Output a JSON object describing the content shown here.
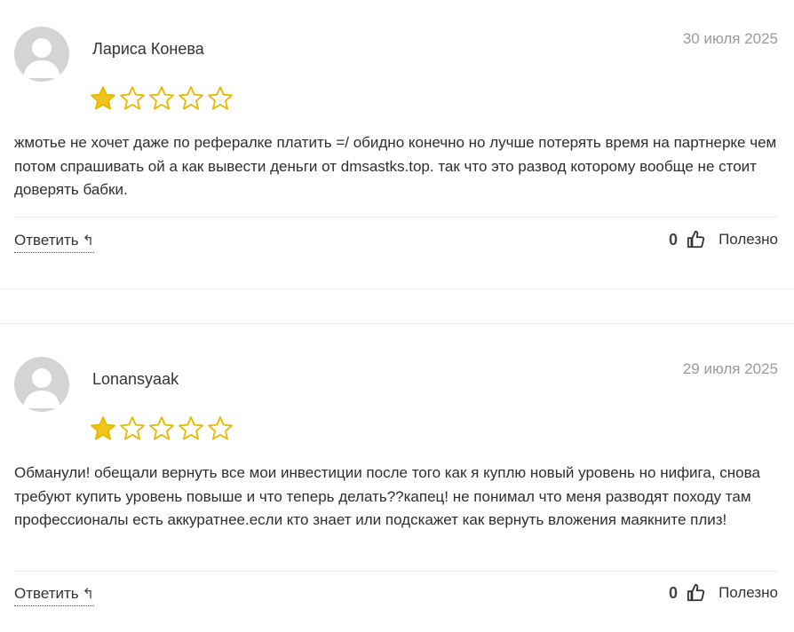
{
  "reviews": [
    {
      "author": "Лариса Конева",
      "date": "30 июля 2025",
      "rating": 1,
      "max_rating": 5,
      "text": "жмотье не хочет даже по рефералке платить =/ обидно конечно но лучше потерять время на партнерке чем потом спрашивать ой а как вывести деньги от dmsastks.top. так что это развод которому вообще не стоит доверять бабки.",
      "reply_label": "Ответить",
      "useful_count": "0",
      "useful_label": "Полезно"
    },
    {
      "author": "Lonansyaak",
      "date": "29 июля 2025",
      "rating": 1,
      "max_rating": 5,
      "text": "Обманули! обещали вернуть все мои инвестиции после того как я куплю новый уровень но нифига, снова требуют купить уровень повыше и что теперь делать??капец! не понимал что меня разводят походу там профессионалы есть аккуратнее.если кто знает или подскажет как вернуть вложения маякните плиз!",
      "reply_label": "Ответить",
      "useful_count": "0",
      "useful_label": "Полезно"
    }
  ],
  "colors": {
    "star_filled": "#f2c418",
    "star_outline": "#e6b800",
    "avatar_bg": "#d4d4d4",
    "avatar_fg": "#ffffff"
  },
  "icons": {
    "avatar": "user-placeholder-icon",
    "star": "star-icon",
    "reply": "reply-arrow-icon",
    "like": "thumbs-up-icon"
  }
}
